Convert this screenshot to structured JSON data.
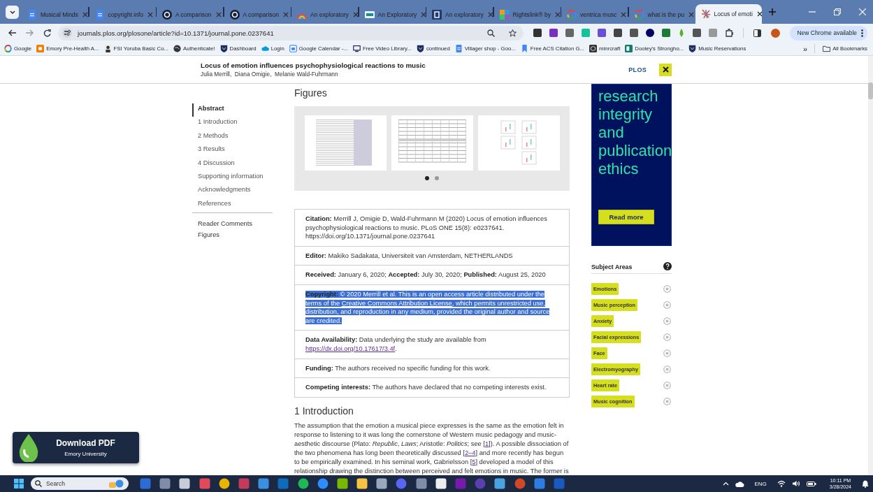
{
  "browser": {
    "tabs": [
      {
        "title": "Musical Minds",
        "kind": "doc",
        "selected": false
      },
      {
        "title": "copyright info",
        "kind": "doc",
        "selected": false
      },
      {
        "title": "A comparison",
        "kind": "ring",
        "selected": false
      },
      {
        "title": "A comparison",
        "kind": "ring",
        "selected": false
      },
      {
        "title": "An exploratory",
        "kind": "rainbow",
        "selected": false
      },
      {
        "title": "An Exploratory",
        "kind": "teal",
        "selected": false
      },
      {
        "title": "An exploratory",
        "kind": "navy",
        "selected": false
      },
      {
        "title": "Rightslink® by",
        "kind": "tiles",
        "selected": false
      },
      {
        "title": "ventrica musc",
        "kind": "google",
        "selected": false
      },
      {
        "title": "what is the pu",
        "kind": "google",
        "selected": false
      },
      {
        "title": "Locus of emoti",
        "kind": "burst",
        "selected": true
      }
    ],
    "url": "journals.plos.org/plosone/article?id=10.1371/journal.pone.0237641",
    "extensions": [
      {
        "kind": "dark"
      },
      {
        "kind": "purple"
      },
      {
        "kind": "dots"
      },
      {
        "kind": "green"
      },
      {
        "kind": "violet"
      },
      {
        "kind": "ghost"
      },
      {
        "kind": "grey"
      },
      {
        "kind": "navydot"
      },
      {
        "kind": "download"
      },
      {
        "kind": "drop"
      },
      {
        "kind": "grey"
      },
      {
        "kind": "lightgrey"
      },
      {
        "kind": "puzzle"
      }
    ],
    "update_button": "New Chrome available",
    "bookmarks": [
      {
        "label": "Google",
        "kind": "google"
      },
      {
        "label": "Emory Pre-Health A...",
        "kind": "orange"
      },
      {
        "label": "FSI Yoruba Basic Co...",
        "kind": "person"
      },
      {
        "label": "Authenticate!",
        "kind": "globe"
      },
      {
        "label": "Dashboard",
        "kind": "shield"
      },
      {
        "label": "Login",
        "kind": "cloud"
      },
      {
        "label": "Google Calendar -...",
        "kind": "calendar"
      },
      {
        "label": "Free Video Library...",
        "kind": "monitor"
      },
      {
        "label": "continued",
        "kind": "shield"
      },
      {
        "label": "Villager shop - Goo...",
        "kind": "doc"
      },
      {
        "label": "Free ACS Citation G...",
        "kind": "bookmark"
      },
      {
        "label": "minrcraft",
        "kind": "cube"
      },
      {
        "label": "Dooley's Strongho...",
        "kind": "sheet"
      },
      {
        "label": "Music Reservations",
        "kind": "shield"
      }
    ],
    "overflow": "»",
    "all_bookmarks": "All Bookmarks"
  },
  "page": {
    "header": {
      "title": "Locus of emotion influences psychophysiological reactions to music",
      "authors": "Julia Merrill,  Diana Omigie,  Melanie Wald-Fuhrmann",
      "logo": "PLOS"
    },
    "nav": [
      {
        "label": "Abstract",
        "selected": true
      },
      {
        "label": "1 Introduction",
        "selected": false
      },
      {
        "label": "2 Methods",
        "selected": false
      },
      {
        "label": "3 Results",
        "selected": false
      },
      {
        "label": "4 Discussion",
        "selected": false
      },
      {
        "label": "Supporting information",
        "selected": false
      },
      {
        "label": "Acknowledgments",
        "selected": false
      },
      {
        "label": "References",
        "selected": false
      }
    ],
    "nav_secondary": [
      {
        "label": "Reader Comments"
      },
      {
        "label": "Figures"
      }
    ],
    "figures": {
      "heading": "Figures",
      "thumbnails": [
        {
          "kind": "table"
        },
        {
          "kind": "grid"
        },
        {
          "kind": "plots"
        }
      ],
      "dots": [
        {
          "selected": true
        },
        {
          "selected": false
        }
      ]
    },
    "article_info": [
      {
        "selected": false,
        "parts": [
          {
            "kind": "text",
            "text": "**Citation:** Merrill J, Omigie D, Wald-Fuhrmann M (2020) Locus of emotion influences psychophysiological reactions to music. PLoS ONE 15(8): e0237641. https://doi.org/10.1371/journal.pone.0237641"
          }
        ]
      },
      {
        "selected": false,
        "parts": [
          {
            "kind": "text",
            "text": "**Editor:** Makiko Sadakata, Universiteit van Amsterdam, NETHERLANDS"
          }
        ]
      },
      {
        "selected": false,
        "parts": [
          {
            "kind": "text",
            "text": "**Received:** January 6, 2020; **Accepted:** July 30, 2020; **Published:** August 25, 2020"
          }
        ]
      },
      {
        "selected": true,
        "parts": [
          {
            "kind": "text",
            "text": "**Copyright:** © 2020 Merrill et al. This is an open access article distributed under the terms of the "
          },
          {
            "kind": "link",
            "text": "Creative Commons Attribution License"
          },
          {
            "kind": "text",
            "text": ", which permits unrestricted use, distribution, and reproduction in any medium, provided the original author and source are credited."
          }
        ]
      },
      {
        "selected": false,
        "parts": [
          {
            "kind": "text",
            "text": "**Data Availability:** Data underlying the study are available from "
          },
          {
            "kind": "link",
            "text": "https://dx.doi.org/10.17617/3.4f"
          },
          {
            "kind": "text",
            "text": "."
          }
        ]
      },
      {
        "selected": false,
        "parts": [
          {
            "kind": "text",
            "text": "**Funding:** The authors received no specific funding for this work."
          }
        ]
      },
      {
        "selected": false,
        "parts": [
          {
            "kind": "text",
            "text": "**Competing interests:** The authors have declared that no competing interests exist."
          }
        ]
      }
    ],
    "intro": {
      "heading": "1 Introduction",
      "parts": [
        {
          "kind": "text",
          "text": "The assumption that the emotion a musical piece expresses is the same as the emotion felt in response to listening to it was long the cornerstone of Western music pedagogy and music-aesthetic discourse (Plato: *Republic*, *Laws*; Aristotle: *Politics*; see ["
        },
        {
          "kind": "link",
          "text": "1"
        },
        {
          "kind": "text",
          "text": "]). A possible dissociation of the two phenomena has long been theoretically discussed ["
        },
        {
          "kind": "link",
          "text": "2–4"
        },
        {
          "kind": "text",
          "text": "] and more recently has begun to be empirically examined. In his seminal work, Gabrielsson ["
        },
        {
          "kind": "link",
          "text": "5"
        },
        {
          "kind": "text",
          "text": "] developed a model of this relationship drawing the distinction between perceived and felt emotions in music. The former is"
        }
      ]
    },
    "ad": {
      "text": "research integrity and publication ethics",
      "button": "Read more"
    },
    "subject_areas": {
      "heading": "Subject Areas",
      "tags": [
        "Emotions",
        "Music perception",
        "Anxiety",
        "Facial expressions",
        "Face",
        "Electromyography",
        "Heart rate",
        "Music cognition"
      ]
    },
    "download_pdf": {
      "title": "Download PDF",
      "subtitle": "Emory University"
    }
  },
  "taskbar": {
    "search_placeholder": "Search",
    "apps": [
      {
        "kind": "widget"
      },
      {
        "kind": "app"
      },
      {
        "kind": "taskview"
      },
      {
        "kind": "red"
      },
      {
        "kind": "chrome"
      },
      {
        "kind": "snip"
      },
      {
        "kind": "store"
      },
      {
        "kind": "mail"
      },
      {
        "kind": "spotify"
      },
      {
        "kind": "zoom"
      },
      {
        "kind": "nvidia"
      },
      {
        "kind": "folder"
      },
      {
        "kind": "calc"
      },
      {
        "kind": "discord"
      },
      {
        "kind": "app"
      },
      {
        "kind": "cube"
      },
      {
        "kind": "onenote"
      },
      {
        "kind": "mu"
      },
      {
        "kind": "notepad"
      },
      {
        "kind": "ppt"
      },
      {
        "kind": "ink"
      },
      {
        "kind": "word"
      }
    ],
    "language": "ENG",
    "time": "10:11 PM",
    "date": "3/28/2024"
  }
}
